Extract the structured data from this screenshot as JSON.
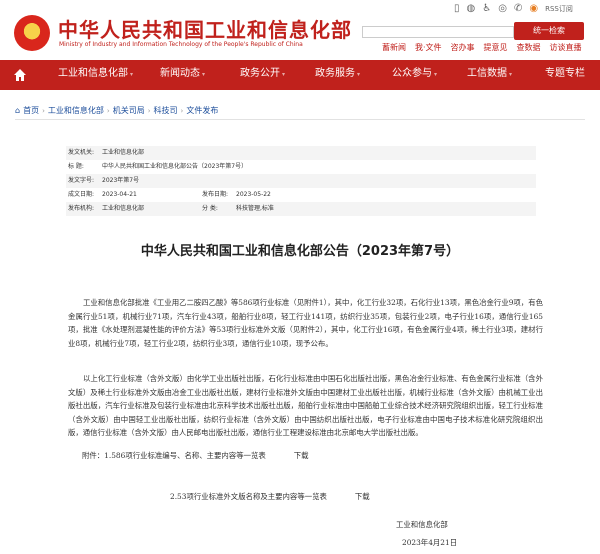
{
  "header": {
    "title": "中华人民共和国工业和信息化部",
    "subtitle": "Ministry of Industry and Information Technology of the People's Republic of China",
    "rss_label": "RSS订阅",
    "search_button": "统一检索",
    "quick_links": [
      "蓄新闻",
      "我·文件",
      "咨办事",
      "提意见",
      "查数据",
      "访谈直播"
    ]
  },
  "nav": {
    "items": [
      "工业和信息化部",
      "新闻动态",
      "政务公开",
      "政务服务",
      "公众参与",
      "工信数据",
      "专题专栏"
    ]
  },
  "breadcrumb": [
    "首页",
    "工业和信息化部",
    "机关司局",
    "科技司",
    "文件发布"
  ],
  "meta": {
    "issuer_label": "发文机关:",
    "issuer": "工业和信息化部",
    "title_label": "标    题:",
    "title": "中华人民共和国工业和信息化部公告（2023年第7号）",
    "number_label": "发文字号:",
    "number": "2023年第7号",
    "date_label": "成文日期:",
    "date": "2023-04-21",
    "pub_label": "发布日期:",
    "pub_date": "2023-05-22",
    "org_label": "发布机构:",
    "org": "工业和信息化部",
    "cat_label": "分    类:",
    "cat": "科技管理,标准"
  },
  "article": {
    "title": "中华人民共和国工业和信息化部公告（2023年第7号）",
    "p1": "工业和信息化部批准《工业用乙二胺四乙酸》等586项行业标准（见附件1），其中，化工行业32项，石化行业13项，黑色冶金行业9项，有色金属行业51项，机械行业71项，汽车行业43项，船舶行业8项，轻工行业141项，纺织行业35项，包装行业2项，电子行业16项，通信行业165项，批准《水处理剂混凝性能的评价方法》等53项行业标准外文版（见附件2），其中，化工行业16项，有色金属行业4项，稀土行业3项，建材行业8项，机械行业7项，轻工行业2项，纺织行业3项，通信行业10项，现予公布。",
    "p2": "以上化工行业标准（含外文版）由化学工业出版社出版，石化行业标准由中国石化出版社出版，黑色冶金行业标准、有色金属行业标准（含外文版）及稀土行业标准外文版由冶金工业出版社出版，建材行业标准外文版由中国建材工业出版社出版，机械行业标准（含外文版）由机械工业出版社出版，汽车行业标准及包装行业标准由北京科学技术出版社出版，船舶行业标准由中国船舶工业综合技术经济研究院组织出版，轻工行业标准（含外文版）由中国轻工业出版社出版，纺织行业标准（含外文版）由中国纺织出版社出版，电子行业标准由中国电子技术标准化研究院组织出版，通信行业标准（含外文版）由人民邮电出版社出版，通信行业工程建设标准由北京邮电大学出版社出版。",
    "attach1": "附件：1.586项行业标准编号、名称、主要内容等一览表",
    "attach2": "2.53项行业标准外文版名称及主要内容等一览表",
    "download": "下载",
    "sign_org": "工业和信息化部",
    "sign_date": "2023年4月21日"
  }
}
